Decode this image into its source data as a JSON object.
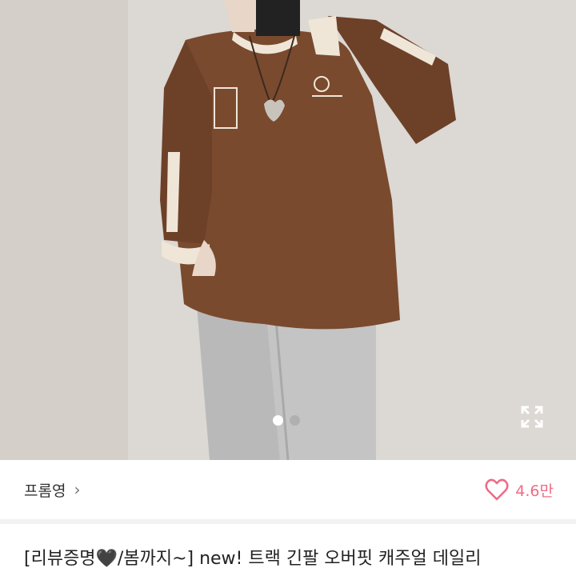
{
  "product": {
    "image_alt": "Person wearing brown oversized long sleeve track sweatshirt with grey pants",
    "carousel_total": 2,
    "carousel_active": 1,
    "expand_icon": "expand-icon"
  },
  "seller": {
    "name": "프롬영",
    "chevron": "›",
    "icon": "chevron-right-icon"
  },
  "likes": {
    "count": "4.6만",
    "icon": "heart-icon"
  },
  "title": {
    "text": "[리뷰증명🖤/봄까지~] new! 트랙 긴팔 오버핏 캐주얼 데일리"
  },
  "colors": {
    "accent": "#f06b86",
    "dot_active": "#ffffff",
    "dot_inactive": "#b0b0b0"
  }
}
